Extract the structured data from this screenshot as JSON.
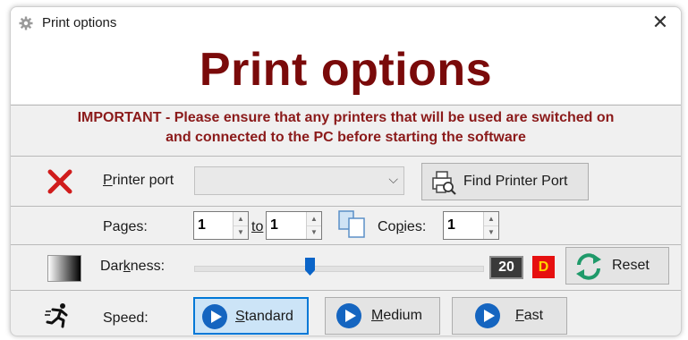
{
  "window": {
    "title": "Print options",
    "close_glyph": "✕"
  },
  "heading": "Print options",
  "important": {
    "line1": "IMPORTANT - Please ensure that any printers that will be used are switched on",
    "line2": "and connected to the PC before starting the software"
  },
  "printer": {
    "status_icon": "x-mark-icon",
    "label_first": "P",
    "label_rest": "rinter port",
    "port_value": "",
    "dropdown_glyph": "⌵",
    "find_button": "Find Printer Port"
  },
  "pages": {
    "label": "Pages:",
    "from": "1",
    "to_label": "to",
    "to": "1",
    "copies_label_a": "Co",
    "copies_label_u": "p",
    "copies_label_b": "ies:",
    "copies": "1",
    "spin_up": "▲",
    "spin_down": "▼"
  },
  "darkness": {
    "label_a": "Dar",
    "label_u": "k",
    "label_b": "ness:",
    "slider_min": 0,
    "slider_max": 50,
    "value": "20",
    "default_badge": "D",
    "reset_button": "Reset"
  },
  "speed": {
    "label": "Speed:",
    "options": [
      {
        "first": "S",
        "rest": "tandard",
        "selected": true
      },
      {
        "first": "M",
        "rest": "edium",
        "selected": false
      },
      {
        "first": "F",
        "rest": "ast",
        "selected": false
      }
    ]
  },
  "colors": {
    "heading": "#7a0a0a",
    "important": "#8b1a1a",
    "selected_button_bg": "#cce4f7",
    "selected_button_border": "#0078d7",
    "play_blue": "#1565c0",
    "reset_green": "#1f9a6a"
  }
}
